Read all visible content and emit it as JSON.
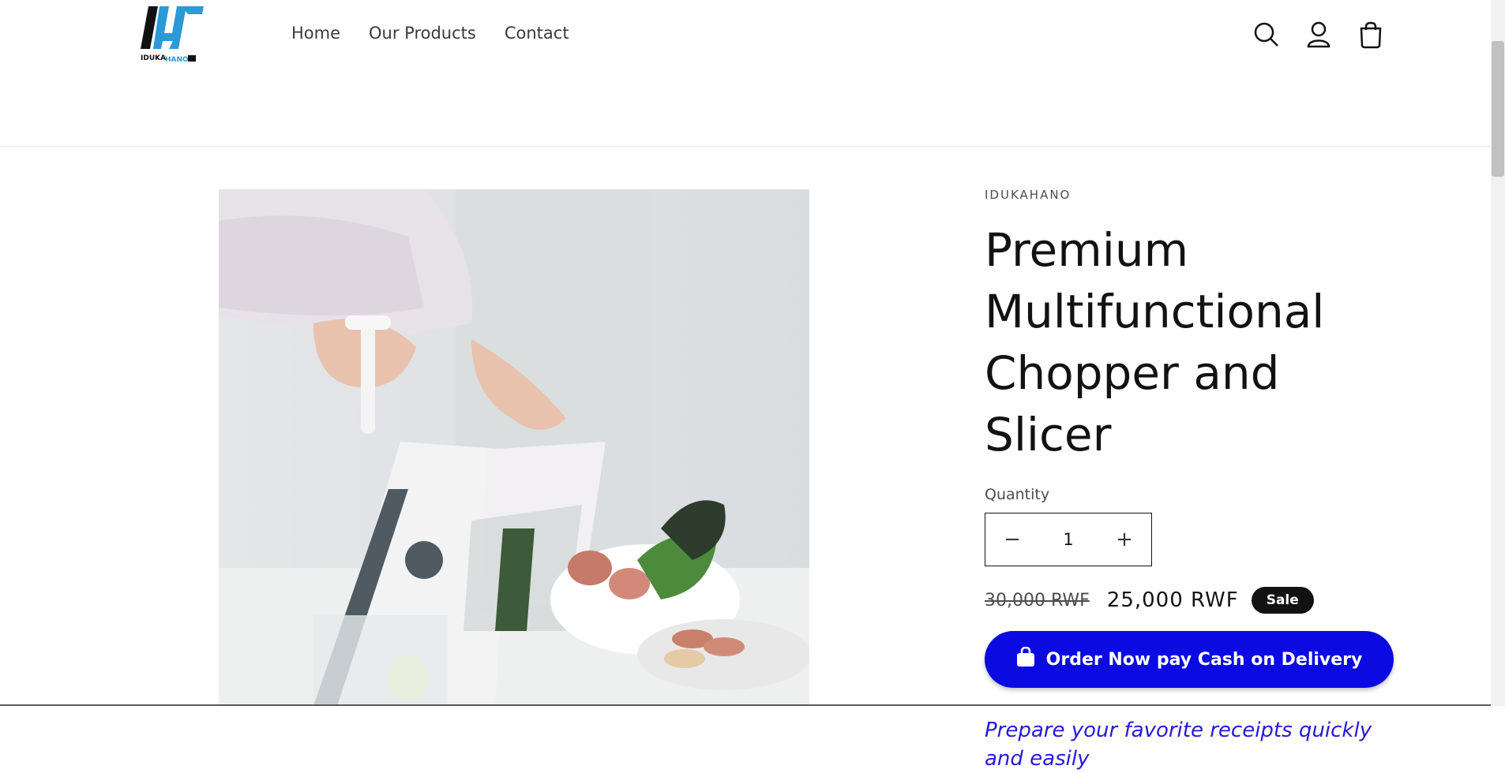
{
  "header": {
    "logo_text": "IDUKAHANO",
    "nav": [
      {
        "label": "Home"
      },
      {
        "label": "Our Products"
      },
      {
        "label": "Contact"
      }
    ],
    "icons": [
      "search-icon",
      "account-icon",
      "cart-icon"
    ]
  },
  "product": {
    "vendor": "IDUKAHANO",
    "title": "Premium Multifunctional Chopper and Slicer",
    "quantity_label": "Quantity",
    "quantity_value": "1",
    "price_regular": "30,000 RWF",
    "price_sale": "25,000 RWF",
    "badge": "Sale",
    "order_button": "Order Now pay Cash on Delivery",
    "tagline": "Prepare your favorite receipts quickly and easily"
  },
  "colors": {
    "accent_blue": "#0a0ae1",
    "tagline_blue": "#2818d8",
    "logo_blue": "#2b9ad6"
  }
}
